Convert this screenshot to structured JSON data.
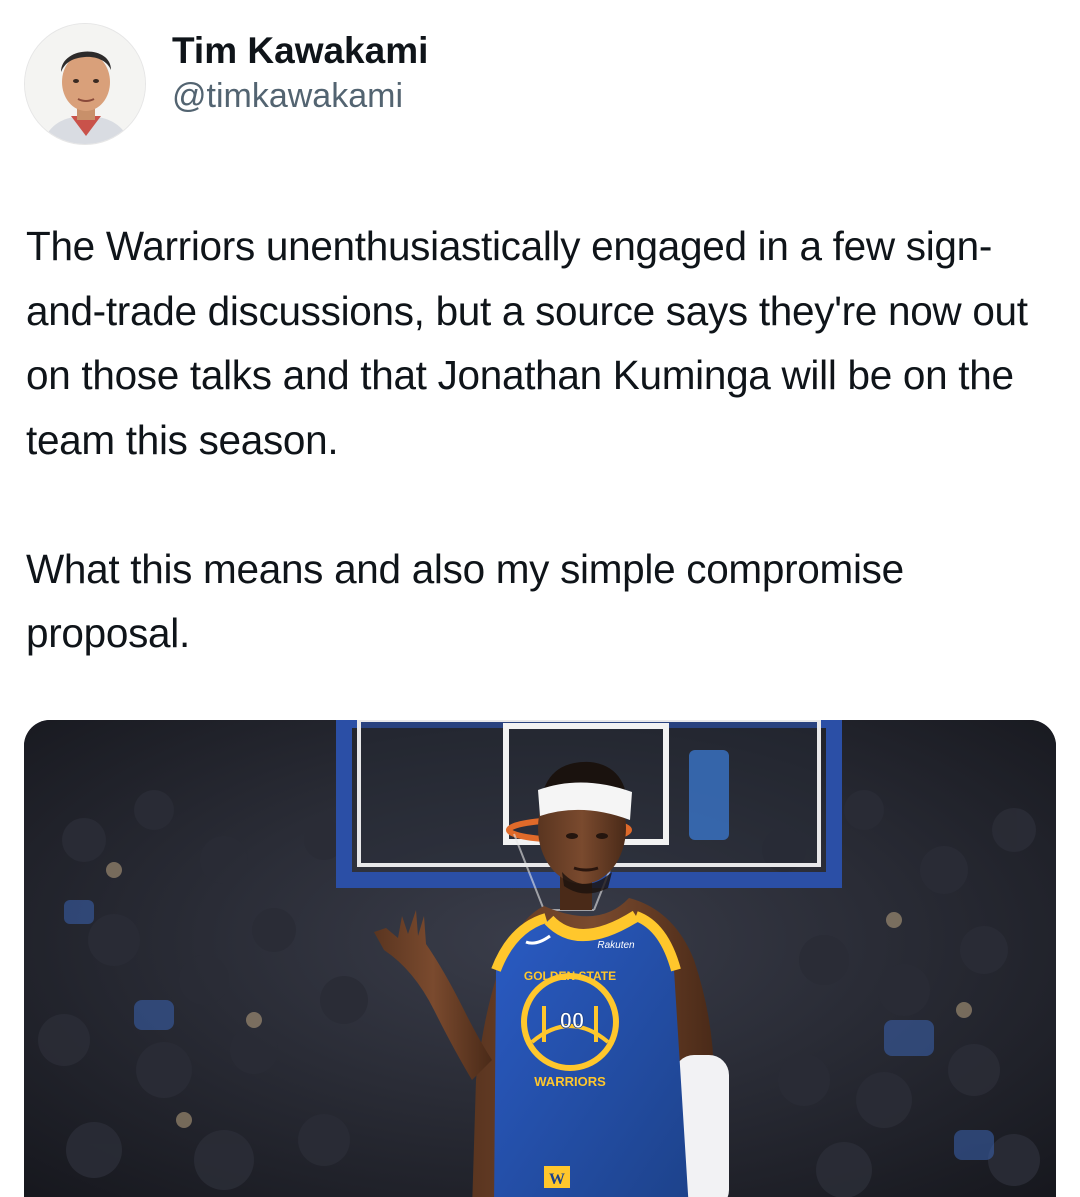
{
  "author": {
    "display_name": "Tim Kawakami",
    "handle": "@timkawakami",
    "avatar_icon": "profile-photo"
  },
  "tweet": {
    "paragraphs": [
      "The Warriors unenthusiastically engaged in a few sign-and-trade discussions, but a source says they're now out on those talks and that Jonathan Kuminga will be on the team this season.",
      "What this means and also my simple compromise proposal."
    ]
  },
  "media": {
    "jersey_brand": "Rakuten",
    "jersey_wordmark_top": "GOLDEN STATE",
    "jersey_wordmark_bottom": "WARRIORS",
    "jersey_number": "00",
    "shorts_logo": "W",
    "colors": {
      "jersey_blue": "#1d428a",
      "jersey_gold": "#ffc72c"
    }
  }
}
